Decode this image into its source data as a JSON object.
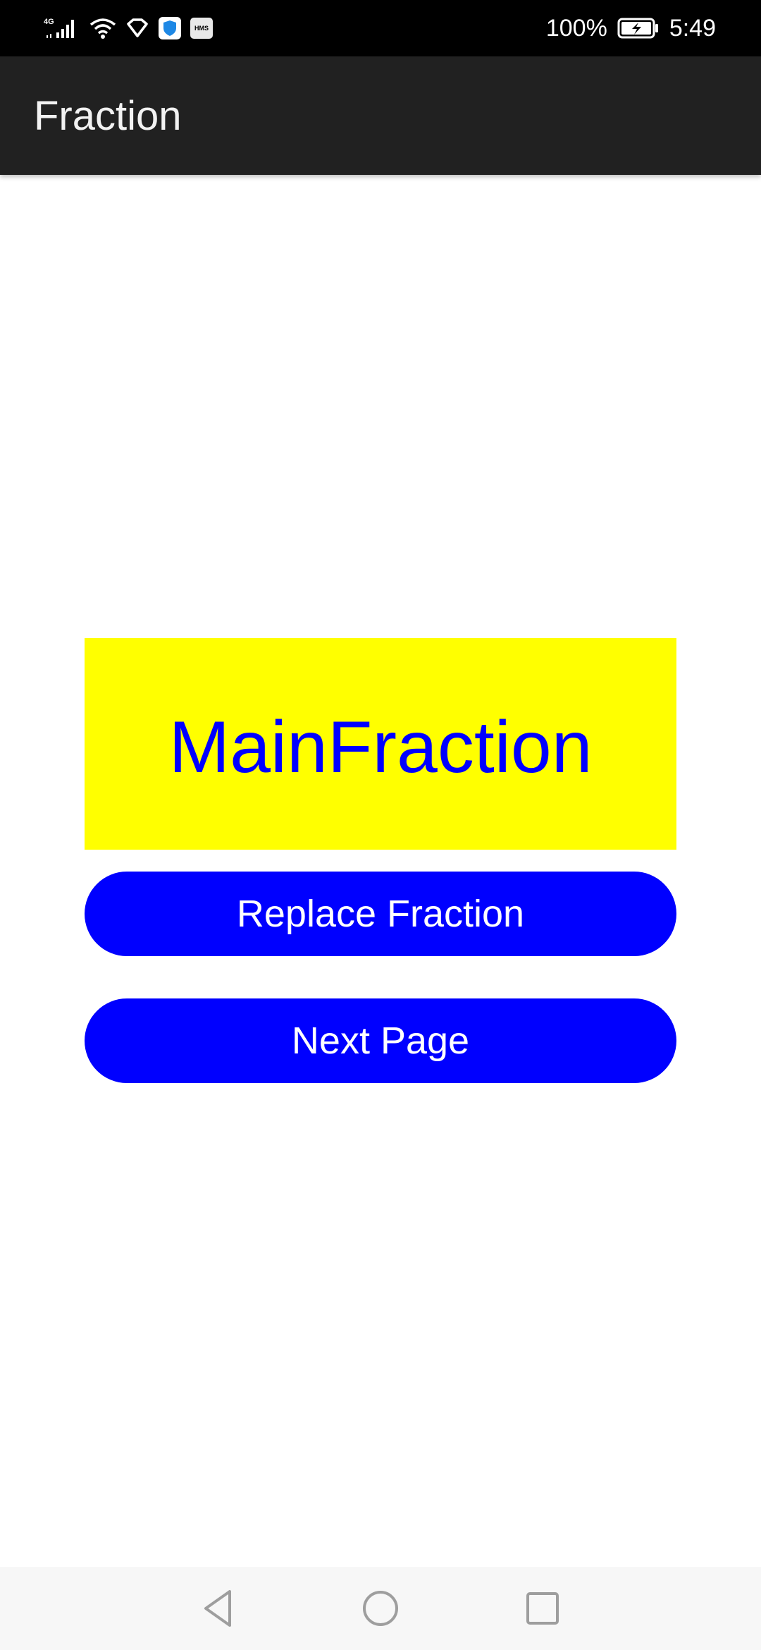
{
  "status_bar": {
    "network_label": "4G",
    "hms_label": "HMS",
    "battery_percent": "100%",
    "time": "5:49",
    "icons": [
      "signal-icon",
      "wifi-icon",
      "location-icon",
      "shield-icon",
      "hms-icon",
      "battery-charging-icon"
    ]
  },
  "app_bar": {
    "title": "Fraction"
  },
  "main": {
    "fraction_label": "MainFraction",
    "replace_button_label": "Replace Fraction",
    "next_button_label": "Next Page"
  },
  "nav_bar": {
    "icons": [
      "back-icon",
      "home-icon",
      "recents-icon"
    ]
  },
  "colors": {
    "app_bar": "#212121",
    "fraction_background": "#ffff00",
    "fraction_text": "#0000ff",
    "button_background": "#0000ff",
    "button_text": "#ffffff"
  }
}
